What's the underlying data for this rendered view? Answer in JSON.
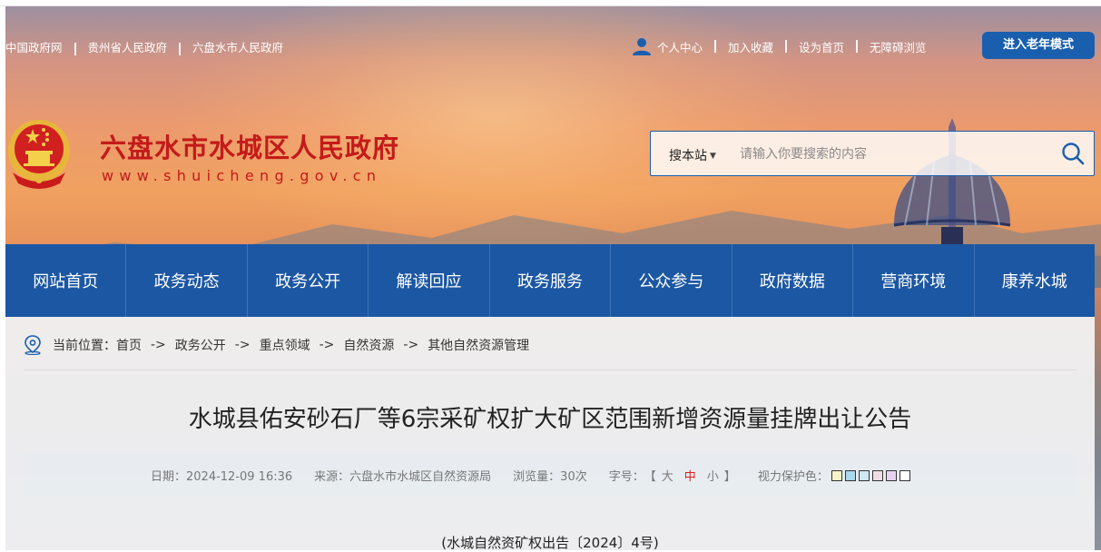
{
  "top_links": {
    "left": [
      "中国政府网",
      "贵州省人民政府",
      "六盘水市人民政府"
    ],
    "right": [
      "个人中心",
      "加入收藏",
      "设为首页",
      "无障碍浏览"
    ],
    "elder_mode": "进入老年模式"
  },
  "header": {
    "title": "六盘水市水城区人民政府",
    "url": "www.shuicheng.gov.cn"
  },
  "search": {
    "scope": "搜本站",
    "placeholder": "请输入你要搜索的内容"
  },
  "nav": [
    "网站首页",
    "政务动态",
    "政务公开",
    "解读回应",
    "政务服务",
    "公众参与",
    "政府数据",
    "营商环境",
    "康养水城"
  ],
  "breadcrumb": {
    "prefix": "当前位置：",
    "items": [
      "首页",
      "政务公开",
      "重点领域",
      "自然资源",
      "其他自然资源管理"
    ]
  },
  "article": {
    "title": "水城县佑安砂石厂等6宗采矿权扩大矿区范围新增资源量挂牌出让公告",
    "date": "日期：2024-12-09 16:36",
    "source": "来源：六盘水市水城区自然资源局",
    "views": "浏览量：30次",
    "font_label": "字号：",
    "font_open": "【",
    "font_large": "大",
    "font_medium": "中",
    "font_small": "小",
    "font_close": "】",
    "eye_label": "视力保护色：",
    "doc_number": "(水城自然资矿权出告〔2024〕4号)"
  },
  "colors": {
    "nav_bg": "#1c57a3",
    "title_red": "#c41a1a",
    "active_font": "#d61d1d",
    "eye_swatches": [
      "#f7f3c6",
      "#a8d8ea",
      "#cfe8f2",
      "#f0dde4",
      "#e7d3f0",
      "#ffffff"
    ]
  }
}
